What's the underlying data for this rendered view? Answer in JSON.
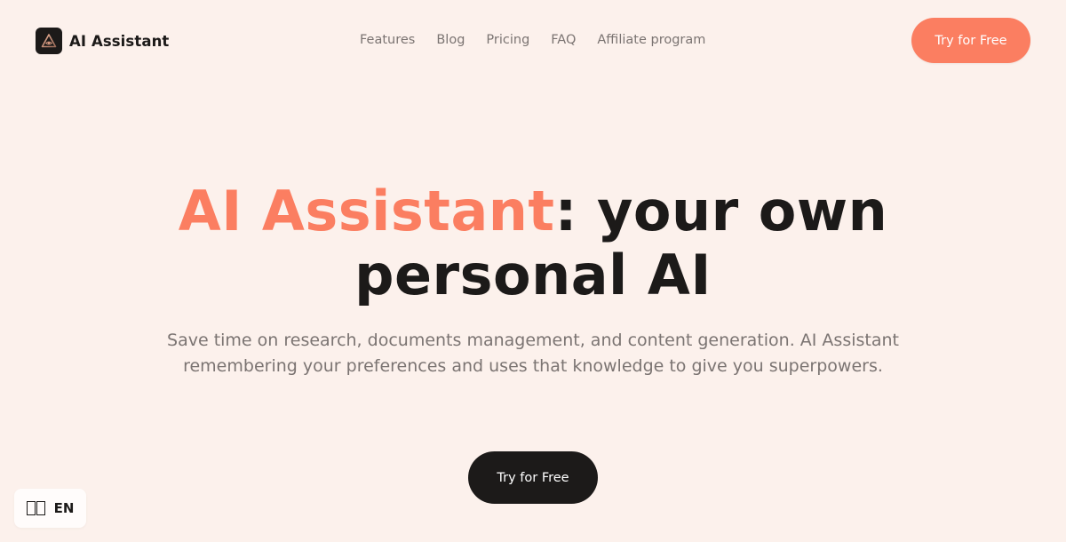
{
  "header": {
    "brand": "AI Assistant",
    "logo_icon": "triangle-eye-icon",
    "nav": [
      {
        "label": "Features"
      },
      {
        "label": "Blog"
      },
      {
        "label": "Pricing"
      },
      {
        "label": "FAQ"
      },
      {
        "label": "Affiliate program"
      }
    ],
    "cta_label": "Try for Free"
  },
  "hero": {
    "title_accent": "AI Assistant",
    "title_rest_line1": ": your own",
    "title_line2": "personal AI",
    "subtitle_line1": "Save time on research, documents management, and content generation. AI Assistant",
    "subtitle_line2": "remembering your preferences and uses that knowledge to give you superpowers.",
    "cta_label": "Try for Free"
  },
  "language_switcher": {
    "flag_icon": "flag-icon",
    "code": "EN"
  },
  "colors": {
    "background": "#fcf1ec",
    "accent": "#fb7e61",
    "dark": "#1c1a19",
    "muted_text": "#7b7472"
  }
}
